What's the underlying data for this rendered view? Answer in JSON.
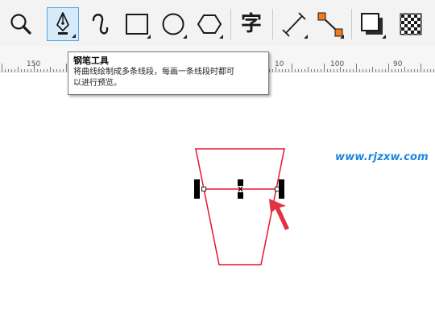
{
  "toolbar": {
    "tools": [
      {
        "icon": "zoom-icon"
      },
      {
        "icon": "pen-tool-icon",
        "active": true
      },
      {
        "icon": "bspline-curve-icon"
      },
      {
        "icon": "rectangle-icon"
      },
      {
        "icon": "ellipse-icon"
      },
      {
        "icon": "polygon-icon"
      },
      {
        "icon": "text-tool-icon",
        "glyph": "字"
      },
      {
        "icon": "dimension-tool-icon"
      },
      {
        "icon": "connector-tool-icon"
      },
      {
        "icon": "drop-shadow-icon"
      },
      {
        "icon": "transparency-icon"
      }
    ]
  },
  "ruler": {
    "labels": [
      "150",
      "10",
      "100",
      "90"
    ]
  },
  "tooltip": {
    "title": "钢笔工具",
    "description_line1": "将曲线绘制成多条线段，每画一条线段时都可",
    "description_line2": "以进行预览。"
  },
  "watermark": {
    "text": "www.rjzxw.com"
  },
  "colors": {
    "shape_stroke": "#e8142a",
    "arrow": "#e43040",
    "handle": "#000000",
    "active_tool_bg": "#d6ebfa",
    "active_tool_border": "#5aa4e0",
    "watermark": "#1b86e0"
  }
}
